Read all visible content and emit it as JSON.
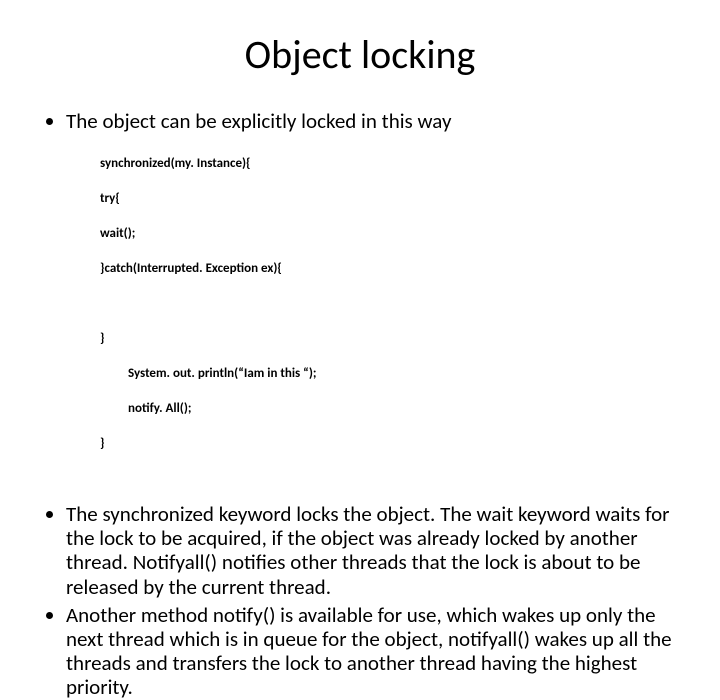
{
  "title": "Object locking",
  "intro": "The object can be explicitly locked in this way",
  "code": {
    "l1": "synchronized(my. Instance){",
    "l2": "try{",
    "l3": "wait();",
    "l4": "}catch(Interrupted. Exception ex){",
    "l5": "}",
    "l6": "System. out. println(“Iam in this “);",
    "l7": "notify. All();",
    "l8": "}"
  },
  "para1": "The synchronized keyword locks the object. The wait keyword waits for the lock to be acquired, if the object was already locked by another thread. Notifyall() notifies other threads that the lock is about to be released by the current thread.",
  "para2": "Another method notify() is available for use, which wakes up only the next thread which is in queue for the object, notifyall() wakes up all the threads and transfers the lock to another thread having the highest priority."
}
